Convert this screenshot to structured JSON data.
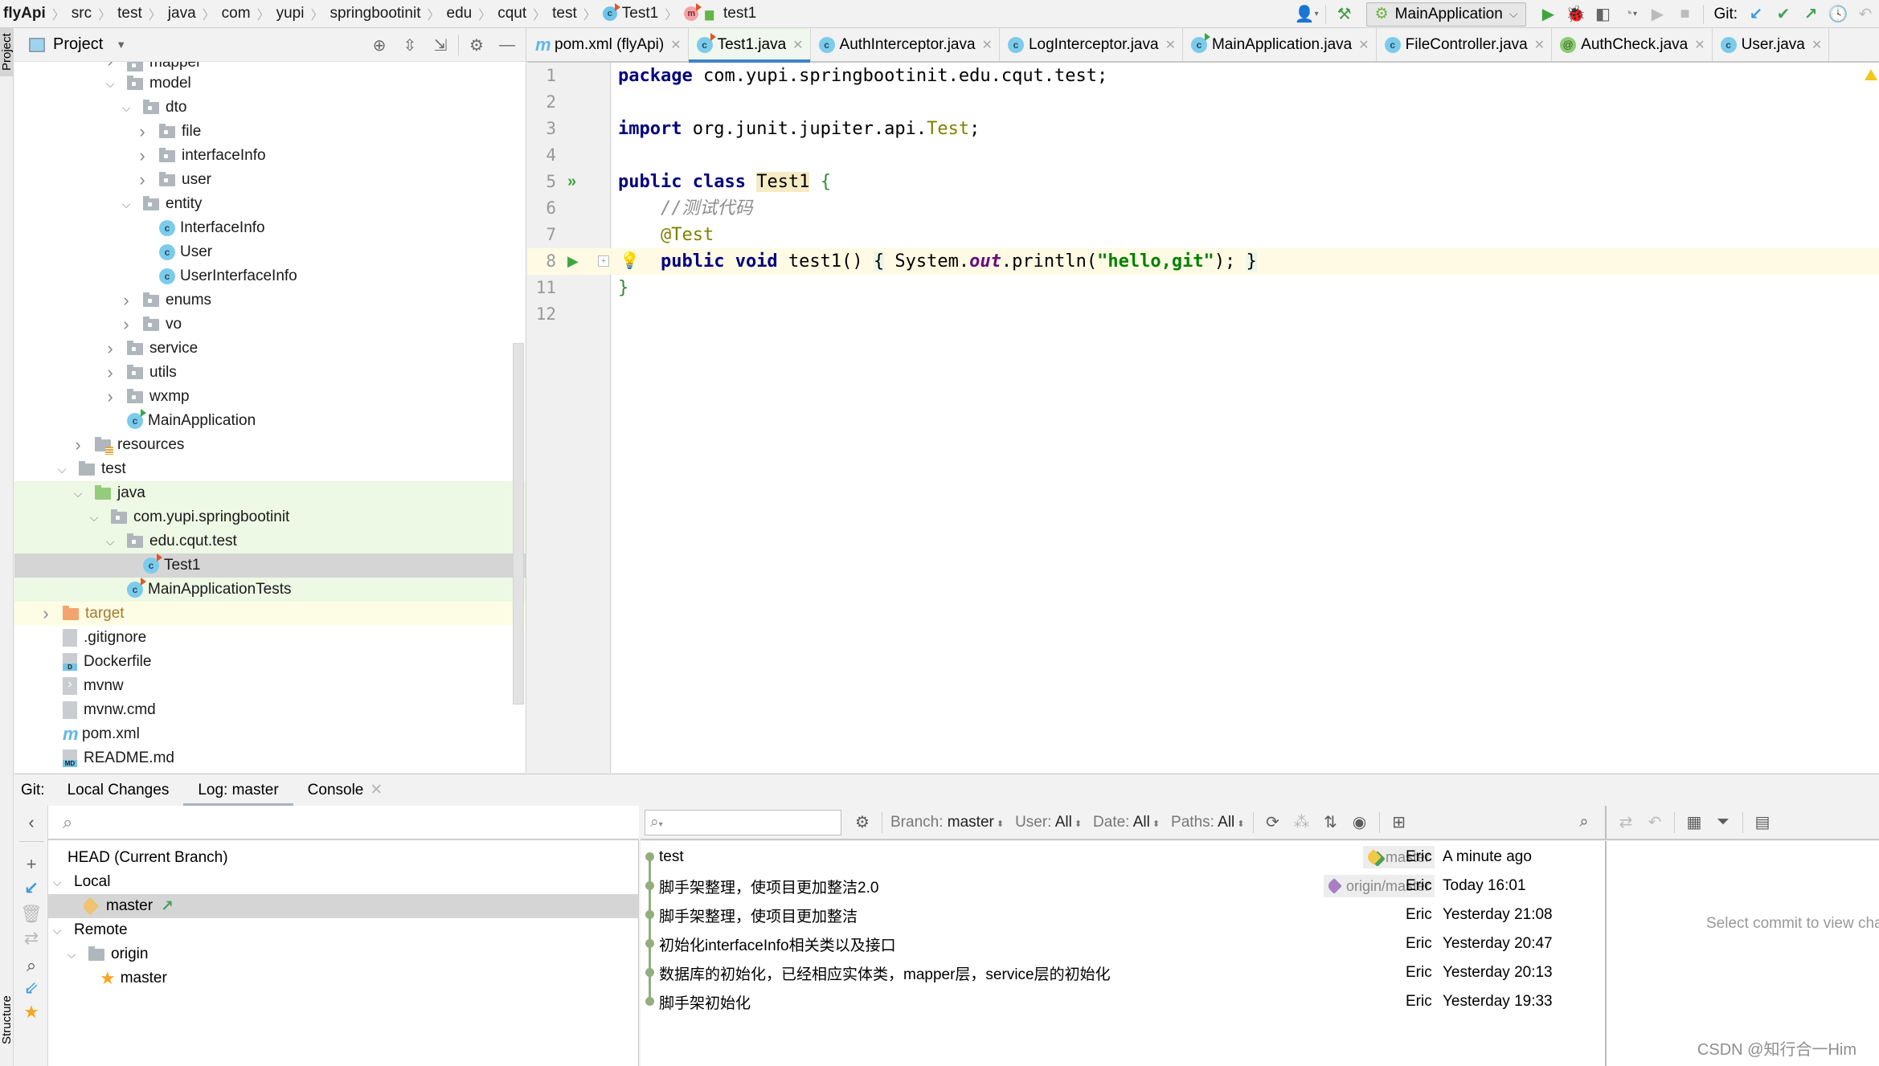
{
  "breadcrumb": [
    "flyApi",
    "src",
    "test",
    "java",
    "com",
    "yupi",
    "springbootinit",
    "edu",
    "cqut",
    "test",
    "Test1",
    "test1"
  ],
  "toolbar": {
    "run_config": "MainApplication",
    "git_label": "Git:"
  },
  "left_strip": {
    "project_tab": "Project",
    "structure_tab": "Structure"
  },
  "project_panel": {
    "title": "Project",
    "tree": [
      {
        "label": "mapper",
        "depth": 5,
        "type": "pkg",
        "arrow": "right",
        "clipped": true
      },
      {
        "label": "model",
        "depth": 5,
        "type": "pkg",
        "arrow": "down"
      },
      {
        "label": "dto",
        "depth": 6,
        "type": "pkg",
        "arrow": "down"
      },
      {
        "label": "file",
        "depth": 7,
        "type": "pkg",
        "arrow": "right"
      },
      {
        "label": "interfaceInfo",
        "depth": 7,
        "type": "pkg",
        "arrow": "right"
      },
      {
        "label": "user",
        "depth": 7,
        "type": "pkg",
        "arrow": "right"
      },
      {
        "label": "entity",
        "depth": 6,
        "type": "pkg",
        "arrow": "down"
      },
      {
        "label": "InterfaceInfo",
        "depth": 7,
        "type": "class",
        "arrow": ""
      },
      {
        "label": "User",
        "depth": 7,
        "type": "class",
        "arrow": ""
      },
      {
        "label": "UserInterfaceInfo",
        "depth": 7,
        "type": "class",
        "arrow": ""
      },
      {
        "label": "enums",
        "depth": 6,
        "type": "pkg",
        "arrow": "right"
      },
      {
        "label": "vo",
        "depth": 6,
        "type": "pkg",
        "arrow": "right"
      },
      {
        "label": "service",
        "depth": 5,
        "type": "pkg",
        "arrow": "right"
      },
      {
        "label": "utils",
        "depth": 5,
        "type": "pkg",
        "arrow": "right"
      },
      {
        "label": "wxmp",
        "depth": 5,
        "type": "pkg",
        "arrow": "right"
      },
      {
        "label": "MainApplication",
        "depth": 5,
        "type": "springclass",
        "arrow": ""
      },
      {
        "label": "resources",
        "depth": 3,
        "type": "res",
        "arrow": "right"
      },
      {
        "label": "test",
        "depth": 2,
        "type": "folder",
        "arrow": "down"
      },
      {
        "label": "java",
        "depth": 3,
        "type": "src",
        "arrow": "down",
        "row": "green"
      },
      {
        "label": "com.yupi.springbootinit",
        "depth": 4,
        "type": "pkg",
        "arrow": "down",
        "row": "green"
      },
      {
        "label": "edu.cqut.test",
        "depth": 5,
        "type": "pkg",
        "arrow": "down",
        "row": "green"
      },
      {
        "label": "Test1",
        "depth": 6,
        "type": "testclass",
        "arrow": "",
        "row": "selected"
      },
      {
        "label": "MainApplicationTests",
        "depth": 5,
        "type": "testclass",
        "arrow": "",
        "row": "green"
      },
      {
        "label": "target",
        "depth": 1,
        "type": "excl",
        "arrow": "right",
        "row": "yellow"
      },
      {
        "label": ".gitignore",
        "depth": 1,
        "type": "file",
        "arrow": ""
      },
      {
        "label": "Dockerfile",
        "depth": 1,
        "type": "docker",
        "arrow": ""
      },
      {
        "label": "mvnw",
        "depth": 1,
        "type": "shell",
        "arrow": ""
      },
      {
        "label": "mvnw.cmd",
        "depth": 1,
        "type": "file",
        "arrow": ""
      },
      {
        "label": "pom.xml",
        "depth": 1,
        "type": "maven",
        "arrow": ""
      },
      {
        "label": "README.md",
        "depth": 1,
        "type": "md",
        "arrow": ""
      }
    ]
  },
  "editor": {
    "tabs": [
      {
        "label": "pom.xml (flyApi)",
        "icon": "maven"
      },
      {
        "label": "Test1.java",
        "icon": "testclass",
        "active": true
      },
      {
        "label": "AuthInterceptor.java",
        "icon": "class"
      },
      {
        "label": "LogInterceptor.java",
        "icon": "class"
      },
      {
        "label": "MainApplication.java",
        "icon": "springclass"
      },
      {
        "label": "FileController.java",
        "icon": "class"
      },
      {
        "label": "AuthCheck.java",
        "icon": "annotation"
      },
      {
        "label": "User.java",
        "icon": "class"
      }
    ],
    "line_numbers": [
      "1",
      "2",
      "3",
      "4",
      "5",
      "6",
      "7",
      "8",
      "11",
      "12"
    ],
    "lines": [
      {
        "kw": "package",
        "rest": " com.yupi.springbootinit.edu.cqut.test;"
      },
      {},
      {
        "kw": "import",
        "rest": " org.junit.jupiter.api.",
        "ann": "Test",
        "end": ";"
      },
      {},
      {
        "kw": "public class",
        "cls": "Test1",
        "brace": "{"
      },
      {
        "comment": "//测试代码"
      },
      {
        "annotation": "@Test"
      },
      {
        "kw": "public void",
        "method": "test1",
        "parens": "()",
        "body_open": "{",
        "sys": "System.",
        "out": "out",
        "call": ".println(",
        "str": "\"hello,git\"",
        "call_end": ");",
        "body_close": "}"
      },
      {
        "brace": "}"
      },
      {}
    ]
  },
  "git": {
    "tabs": {
      "label": "Git:",
      "local_changes": "Local Changes",
      "log": "Log: master",
      "console": "Console"
    },
    "branches": {
      "head": "HEAD (Current Branch)",
      "local": "Local",
      "local_master": "master",
      "remote": "Remote",
      "origin": "origin",
      "origin_master": "master"
    },
    "filters": {
      "branch_label": "Branch:",
      "branch_value": "master",
      "user_label": "User:",
      "user_value": "All",
      "date_label": "Date:",
      "date_value": "All",
      "paths_label": "Paths:",
      "paths_value": "All"
    },
    "commits": [
      {
        "message": "test",
        "ref": "master",
        "author": "Eric",
        "date": "A minute ago"
      },
      {
        "message": "脚手架整理，使项目更加整洁2.0",
        "ref": "origin/master",
        "author": "Eric",
        "date": "Today 16:01"
      },
      {
        "message": "脚手架整理，使项目更加整洁",
        "ref": "",
        "author": "Eric",
        "date": "Yesterday 21:08"
      },
      {
        "message": "初始化interfaceInfo相关类以及接口",
        "ref": "",
        "author": "Eric",
        "date": "Yesterday 20:47"
      },
      {
        "message": "数据库的初始化，已经相应实体类，mapper层，service层的初始化",
        "ref": "",
        "author": "Eric",
        "date": "Yesterday 20:13"
      },
      {
        "message": "脚手架初始化",
        "ref": "",
        "author": "Eric",
        "date": "Yesterday 19:33"
      }
    ],
    "details_hint": "Select commit to view cha"
  },
  "watermark": "CSDN @知行合一Him",
  "colors": {
    "accent": "#4083c9",
    "graph": "#95ac7d",
    "local_ref": "#f0c94a",
    "remote_ref": "#a97fc4"
  }
}
